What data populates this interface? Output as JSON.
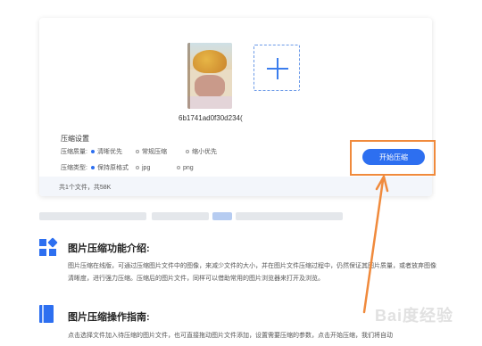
{
  "upload": {
    "filename": "6b1741ad0f30d234("
  },
  "settings": {
    "title": "压缩设置",
    "quality_label": "压缩质量:",
    "quality_options": [
      "清晰优先",
      "常规压缩",
      "缩小优先"
    ],
    "quality_selected": 0,
    "type_label": "压缩类型:",
    "type_options": [
      "保持原格式",
      "jpg",
      "png"
    ],
    "type_selected": 0
  },
  "start_button": "开始压缩",
  "file_count": "共1个文件，共58K",
  "sections": [
    {
      "title": "图片压缩功能介绍:",
      "text": "图片压缩在线版，可通过压缩图片文件中的图像，来减少文件的大小，并在图片文件压缩过程中，仍然保证其图片质量，或者放弃图像清晰度，进行强力压缩。压缩后的图片文件，同样可以借助常用的图片浏览器来打开及浏览。",
      "icon": "grid-icon"
    },
    {
      "title": "图片压缩操作指南:",
      "text": "点击选择文件加入待压缩的图片文件，也可直接拖动图片文件添加，设置需要压缩的参数，点击开始压缩，我们将自动",
      "icon": "book-icon"
    }
  ],
  "watermark": "Bai度经验",
  "colors": {
    "accent": "#2d6ff0",
    "highlight": "#f08a3c"
  }
}
